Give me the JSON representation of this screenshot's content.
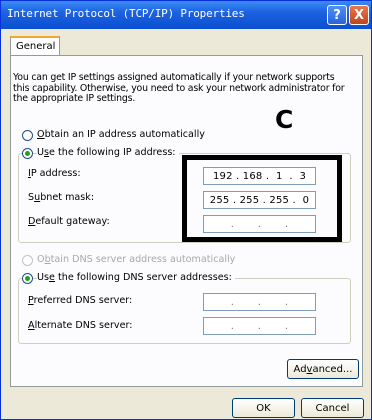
{
  "window": {
    "title": "Internet Protocol (TCP/IP) Properties",
    "help_label": "?",
    "close_label": "X"
  },
  "tabs": [
    {
      "label": "General"
    }
  ],
  "intro_text": "You can get IP settings assigned automatically if your network supports this capability. Otherwise, you need to ask your network administrator for the appropriate IP settings.",
  "ip_section": {
    "obtain_auto_label_u": "O",
    "obtain_auto_label_rest": "btain an IP address automatically",
    "use_following_u": "s",
    "use_following_pre": "U",
    "use_following_rest": "e the following IP address:",
    "fields": [
      {
        "label_u": "I",
        "label_rest": "P address:",
        "value": "192 . 168 .  1  .  3"
      },
      {
        "label_pre": "S",
        "label_u": "u",
        "label_rest": "bnet mask:",
        "value": "255 . 255 . 255 .  0"
      },
      {
        "label_u": "D",
        "label_rest": "efault gateway:",
        "value": "  .       .       .  "
      }
    ],
    "selected": "use_following"
  },
  "dns_section": {
    "obtain_auto_label_pre": "O",
    "obtain_auto_label_u": "b",
    "obtain_auto_label_rest": "tain DNS server address automatically",
    "use_following_pre": "Us",
    "use_following_u": "e",
    "use_following_rest": " the following DNS server addresses:",
    "fields": [
      {
        "label_u": "P",
        "label_rest": "referred DNS server:",
        "value": "  .       .       .  "
      },
      {
        "label_u": "A",
        "label_rest": "lternate DNS server:",
        "value": "  .       .       .  "
      }
    ],
    "selected": "use_following"
  },
  "annotation": {
    "letter": "C"
  },
  "buttons": {
    "advanced_pre": "Ad",
    "advanced_u": "v",
    "advanced_rest": "anced...",
    "ok": "OK",
    "cancel": "Cancel"
  }
}
